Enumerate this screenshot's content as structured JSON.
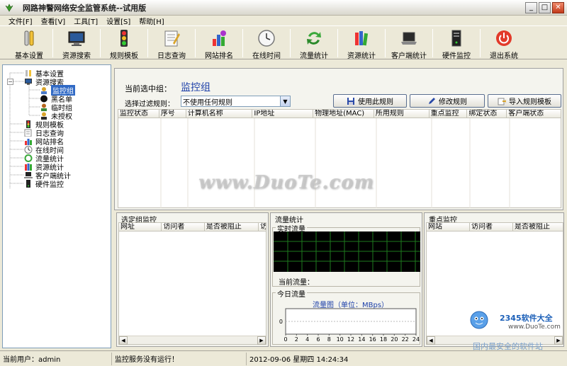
{
  "window": {
    "title": "网路神警网络安全监管系统--试用版"
  },
  "menu": [
    {
      "label": "文件[F]"
    },
    {
      "label": "查看[V]"
    },
    {
      "label": "工具[T]"
    },
    {
      "label": "设置[S]"
    },
    {
      "label": "帮助[H]"
    }
  ],
  "toolbar": [
    {
      "label": "基本设置",
      "icon": "wrench-icon"
    },
    {
      "label": "资源搜索",
      "icon": "monitor-icon"
    },
    {
      "label": "规则模板",
      "icon": "traffic-light-icon"
    },
    {
      "label": "日志查询",
      "icon": "log-icon"
    },
    {
      "label": "网站排名",
      "icon": "globe-icon"
    },
    {
      "label": "在线时间",
      "icon": "clock-icon"
    },
    {
      "label": "流量统计",
      "icon": "recycle-icon"
    },
    {
      "label": "资源统计",
      "icon": "books-icon"
    },
    {
      "label": "客户端统计",
      "icon": "laptop-icon"
    },
    {
      "label": "硬件监控",
      "icon": "server-icon"
    },
    {
      "label": "退出系统",
      "icon": "power-icon"
    }
  ],
  "tree": {
    "items": [
      {
        "label": "基本设置"
      },
      {
        "label": "资源搜索"
      },
      {
        "label": "监控组"
      },
      {
        "label": "黑名单"
      },
      {
        "label": "临时组"
      },
      {
        "label": "未授权"
      },
      {
        "label": "规则模板"
      },
      {
        "label": "日志查询"
      },
      {
        "label": "网站排名"
      },
      {
        "label": "在线时间"
      },
      {
        "label": "流量统计"
      },
      {
        "label": "资源统计"
      },
      {
        "label": "客户端统计"
      },
      {
        "label": "硬件监控"
      }
    ]
  },
  "main": {
    "group_label": "当前选中组：",
    "group_value": "监控组",
    "filter_label": "选择过滤规则：",
    "filter_value": "不使用任何规则",
    "buttons": {
      "use_rule": "使用此规则",
      "edit_rule": "修改规则",
      "import_template": "导入规则模板"
    },
    "columns": [
      "监控状态",
      "序号",
      "计算机名称",
      "IP地址",
      "物理地址(MAC)",
      "所用规则",
      "重点监控",
      "绑定状态",
      "客户端状态"
    ]
  },
  "selected_group_panel": {
    "title": "选定组监控",
    "columns": [
      "网址",
      "访问者",
      "是否被阻止",
      "访"
    ]
  },
  "traffic_panel": {
    "title": "流量统计",
    "realtime_label": "实时流量",
    "current_label": "当前流量：",
    "today_label": "今日流量",
    "chart_title": "流量图（单位：MBps）"
  },
  "key_panel": {
    "title": "重点监控",
    "columns": [
      "网站",
      "访问者",
      "是否被阻止"
    ]
  },
  "status": {
    "user": "当前用户：admin",
    "service": "监控服务没有运行！",
    "datetime": "2012-09-06 星期四 14:24:34"
  },
  "watermark": "www.DuoTe.com",
  "brand": {
    "name": "2345软件大全",
    "url": "www.DuoTe.com",
    "slogan": "国内最安全的软件站"
  },
  "chart_data": {
    "type": "line",
    "title": "流量图（单位：MBps）",
    "x_ticks": [
      0,
      2,
      4,
      6,
      8,
      10,
      12,
      14,
      16,
      18,
      20,
      22,
      24
    ],
    "y_ticks": [
      0
    ],
    "series": []
  }
}
